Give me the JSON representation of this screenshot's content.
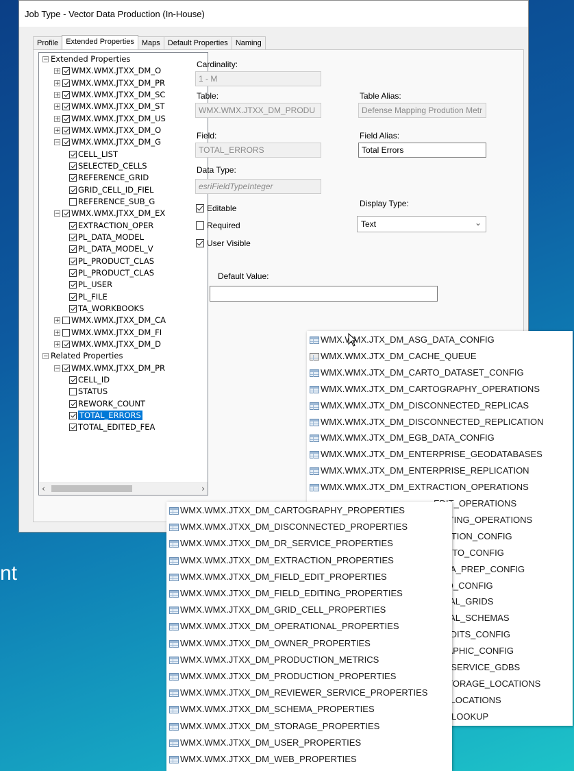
{
  "background_text": "nt",
  "dialog": {
    "title": "Job Type - Vector Data Production (In-House)",
    "tabs": [
      "Profile",
      "Extended Properties",
      "Maps",
      "Default Properties",
      "Naming"
    ],
    "active_tab": "Extended Properties"
  },
  "tree": {
    "items": [
      {
        "level": 0,
        "expander": "minus",
        "checkbox": false,
        "label": "Extended Properties"
      },
      {
        "level": 1,
        "expander": "plus",
        "checkbox": true,
        "checked": true,
        "label": "WMX.WMX.JTXX_DM_O"
      },
      {
        "level": 1,
        "expander": "plus",
        "checkbox": true,
        "checked": true,
        "label": "WMX.WMX.JTXX_DM_PR"
      },
      {
        "level": 1,
        "expander": "plus",
        "checkbox": true,
        "checked": true,
        "label": "WMX.WMX.JTXX_DM_SC"
      },
      {
        "level": 1,
        "expander": "plus",
        "checkbox": true,
        "checked": true,
        "label": "WMX.WMX.JTXX_DM_ST"
      },
      {
        "level": 1,
        "expander": "plus",
        "checkbox": true,
        "checked": true,
        "label": "WMX.WMX.JTXX_DM_US"
      },
      {
        "level": 1,
        "expander": "plus",
        "checkbox": true,
        "checked": true,
        "label": "WMX.WMX.JTXX_DM_O"
      },
      {
        "level": 1,
        "expander": "minus",
        "checkbox": true,
        "checked": true,
        "label": "WMX.WMX.JTXX_DM_G"
      },
      {
        "level": 2,
        "checkbox": true,
        "checked": true,
        "label": "CELL_LIST"
      },
      {
        "level": 2,
        "checkbox": true,
        "checked": true,
        "label": "SELECTED_CELLS"
      },
      {
        "level": 2,
        "checkbox": true,
        "checked": true,
        "label": "REFERENCE_GRID"
      },
      {
        "level": 2,
        "checkbox": true,
        "checked": true,
        "label": "GRID_CELL_ID_FIEL"
      },
      {
        "level": 2,
        "checkbox": true,
        "checked": false,
        "label": "REFERENCE_SUB_G"
      },
      {
        "level": 1,
        "expander": "minus",
        "checkbox": true,
        "checked": true,
        "label": "WMX.WMX.JTXX_DM_EX"
      },
      {
        "level": 2,
        "checkbox": true,
        "checked": true,
        "label": "EXTRACTION_OPER"
      },
      {
        "level": 2,
        "checkbox": true,
        "checked": true,
        "label": "PL_DATA_MODEL"
      },
      {
        "level": 2,
        "checkbox": true,
        "checked": true,
        "label": "PL_DATA_MODEL_V"
      },
      {
        "level": 2,
        "checkbox": true,
        "checked": true,
        "label": "PL_PRODUCT_CLAS"
      },
      {
        "level": 2,
        "checkbox": true,
        "checked": true,
        "label": "PL_PRODUCT_CLAS"
      },
      {
        "level": 2,
        "checkbox": true,
        "checked": true,
        "label": "PL_USER"
      },
      {
        "level": 2,
        "checkbox": true,
        "checked": true,
        "label": "PL_FILE"
      },
      {
        "level": 2,
        "checkbox": true,
        "checked": true,
        "label": "TA_WORKBOOKS"
      },
      {
        "level": 1,
        "expander": "plus",
        "checkbox": true,
        "checked": false,
        "label": "WMX.WMX.JTXX_DM_CA"
      },
      {
        "level": 1,
        "expander": "plus",
        "checkbox": true,
        "checked": false,
        "label": "WMX.WMX.JTXX_DM_FI"
      },
      {
        "level": 1,
        "expander": "plus",
        "checkbox": true,
        "checked": true,
        "label": "WMX.WMX.JTXX_DM_D"
      },
      {
        "level": 0,
        "expander": "minus",
        "checkbox": false,
        "label": "Related Properties"
      },
      {
        "level": 1,
        "expander": "minus",
        "checkbox": true,
        "checked": true,
        "label": "WMX.WMX.JTXX_DM_PR"
      },
      {
        "level": 2,
        "checkbox": true,
        "checked": true,
        "label": "CELL_ID"
      },
      {
        "level": 2,
        "checkbox": true,
        "checked": false,
        "label": "STATUS"
      },
      {
        "level": 2,
        "checkbox": true,
        "checked": true,
        "label": "REWORK_COUNT"
      },
      {
        "level": 2,
        "checkbox": true,
        "checked": true,
        "label": "TOTAL_ERRORS",
        "selected": true
      },
      {
        "level": 2,
        "checkbox": true,
        "checked": true,
        "label": "TOTAL_EDITED_FEA"
      }
    ]
  },
  "form": {
    "cardinality_label": "Cardinality:",
    "cardinality_value": "1 - M",
    "table_label": "Table:",
    "table_value": "WMX.WMX.JTXX_DM_PRODU",
    "table_alias_label": "Table Alias:",
    "table_alias_value": "Defense Mapping Prodution Metr",
    "field_label": "Field:",
    "field_value": "TOTAL_ERRORS",
    "field_alias_label": "Field Alias:",
    "field_alias_value": "Total Errors",
    "data_type_label": "Data Type:",
    "data_type_value": "esriFieldTypeInteger",
    "editable_label": "Editable",
    "editable": true,
    "required_label": "Required",
    "required": false,
    "user_visible_label": "User Visible",
    "user_visible": true,
    "display_type_label": "Display Type:",
    "display_type_value": "Text",
    "default_value_label": "Default Value:",
    "default_value": ""
  },
  "popup_right": {
    "items": [
      "WMX.WMX.JTX_DM_ASG_DATA_CONFIG",
      "WMX.WMX.JTX_DM_CACHE_QUEUE",
      "WMX.WMX.JTX_DM_CARTO_DATASET_CONFIG",
      "WMX.WMX.JTX_DM_CARTOGRAPHY_OPERATIONS",
      "WMX.WMX.JTX_DM_DISCONNECTED_REPLICAS",
      "WMX.WMX.JTX_DM_DISCONNECTED_REPLICATION",
      "WMX.WMX.JTX_DM_EGB_DATA_CONFIG",
      "WMX.WMX.JTX_DM_ENTERPRISE_GEODATABASES",
      "WMX.WMX.JTX_DM_ENTERPRISE_REPLICATION",
      "WMX.WMX.JTX_DM_EXTRACTION_OPERATIONS",
      "EDIT_OPERATIONS",
      "EDITING_OPERATIONS",
      "REATION_CONFIG",
      "CARTO_CONFIG",
      "DATA_PREP_CONFIG",
      "NNO_CONFIG",
      "IONAL_GRIDS",
      "IONAL_SCHEMAS",
      "S_EDITS_CONFIG",
      "GRAPHIC_CONFIG",
      "ER_SERVICE_GDBS",
      ")_STORAGE_LOCATIONS",
      "SE_LOCATIONS",
      "GY_LOOKUP"
    ]
  },
  "popup_left": {
    "items": [
      "WMX.WMX.JTXX_DM_CARTOGRAPHY_PROPERTIES",
      "WMX.WMX.JTXX_DM_DISCONNECTED_PROPERTIES",
      "WMX.WMX.JTXX_DM_DR_SERVICE_PROPERTIES",
      "WMX.WMX.JTXX_DM_EXTRACTION_PROPERTIES",
      "WMX.WMX.JTXX_DM_FIELD_EDIT_PROPERTIES",
      "WMX.WMX.JTXX_DM_FIELD_EDITING_PROPERTIES",
      "WMX.WMX.JTXX_DM_GRID_CELL_PROPERTIES",
      "WMX.WMX.JTXX_DM_OPERATIONAL_PROPERTIES",
      "WMX.WMX.JTXX_DM_OWNER_PROPERTIES",
      "WMX.WMX.JTXX_DM_PRODUCTION_METRICS",
      "WMX.WMX.JTXX_DM_PRODUCTION_PROPERTIES",
      "WMX.WMX.JTXX_DM_REVIEWER_SERVICE_PROPERTIES",
      "WMX.WMX.JTXX_DM_SCHEMA_PROPERTIES",
      "WMX.WMX.JTXX_DM_STORAGE_PROPERTIES",
      "WMX.WMX.JTXX_DM_USER_PROPERTIES",
      "WMX.WMX.JTXX_DM_WEB_PROPERTIES"
    ]
  }
}
